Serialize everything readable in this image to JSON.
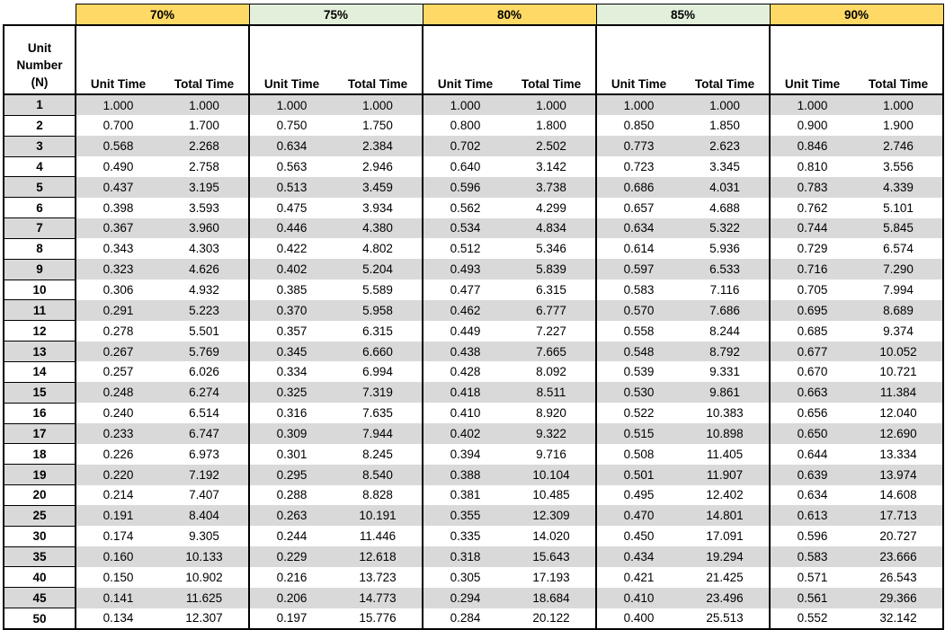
{
  "colors": {
    "yellow": "#ffd966",
    "green": "#e2efda",
    "row_gray": "#d9d9d9"
  },
  "header": {
    "unit_label_line1": "Unit",
    "unit_label_line2": "Number",
    "unit_label_line3": "(N)",
    "unit_time_label": "Unit Time",
    "total_time_label": "Total Time"
  },
  "groups": [
    {
      "label": "70%",
      "color": "#ffd966"
    },
    {
      "label": "75%",
      "color": "#e2efda"
    },
    {
      "label": "80%",
      "color": "#ffd966"
    },
    {
      "label": "85%",
      "color": "#e2efda"
    },
    {
      "label": "90%",
      "color": "#ffd966"
    }
  ],
  "rows": [
    {
      "n": "1",
      "values": [
        "1.000",
        "1.000",
        "1.000",
        "1.000",
        "1.000",
        "1.000",
        "1.000",
        "1.000",
        "1.000",
        "1.000"
      ]
    },
    {
      "n": "2",
      "values": [
        "0.700",
        "1.700",
        "0.750",
        "1.750",
        "0.800",
        "1.800",
        "0.850",
        "1.850",
        "0.900",
        "1.900"
      ]
    },
    {
      "n": "3",
      "values": [
        "0.568",
        "2.268",
        "0.634",
        "2.384",
        "0.702",
        "2.502",
        "0.773",
        "2.623",
        "0.846",
        "2.746"
      ]
    },
    {
      "n": "4",
      "values": [
        "0.490",
        "2.758",
        "0.563",
        "2.946",
        "0.640",
        "3.142",
        "0.723",
        "3.345",
        "0.810",
        "3.556"
      ]
    },
    {
      "n": "5",
      "values": [
        "0.437",
        "3.195",
        "0.513",
        "3.459",
        "0.596",
        "3.738",
        "0.686",
        "4.031",
        "0.783",
        "4.339"
      ]
    },
    {
      "n": "6",
      "values": [
        "0.398",
        "3.593",
        "0.475",
        "3.934",
        "0.562",
        "4.299",
        "0.657",
        "4.688",
        "0.762",
        "5.101"
      ]
    },
    {
      "n": "7",
      "values": [
        "0.367",
        "3.960",
        "0.446",
        "4.380",
        "0.534",
        "4.834",
        "0.634",
        "5.322",
        "0.744",
        "5.845"
      ]
    },
    {
      "n": "8",
      "values": [
        "0.343",
        "4.303",
        "0.422",
        "4.802",
        "0.512",
        "5.346",
        "0.614",
        "5.936",
        "0.729",
        "6.574"
      ]
    },
    {
      "n": "9",
      "values": [
        "0.323",
        "4.626",
        "0.402",
        "5.204",
        "0.493",
        "5.839",
        "0.597",
        "6.533",
        "0.716",
        "7.290"
      ]
    },
    {
      "n": "10",
      "values": [
        "0.306",
        "4.932",
        "0.385",
        "5.589",
        "0.477",
        "6.315",
        "0.583",
        "7.116",
        "0.705",
        "7.994"
      ]
    },
    {
      "n": "11",
      "values": [
        "0.291",
        "5.223",
        "0.370",
        "5.958",
        "0.462",
        "6.777",
        "0.570",
        "7.686",
        "0.695",
        "8.689"
      ]
    },
    {
      "n": "12",
      "values": [
        "0.278",
        "5.501",
        "0.357",
        "6.315",
        "0.449",
        "7.227",
        "0.558",
        "8.244",
        "0.685",
        "9.374"
      ]
    },
    {
      "n": "13",
      "values": [
        "0.267",
        "5.769",
        "0.345",
        "6.660",
        "0.438",
        "7.665",
        "0.548",
        "8.792",
        "0.677",
        "10.052"
      ]
    },
    {
      "n": "14",
      "values": [
        "0.257",
        "6.026",
        "0.334",
        "6.994",
        "0.428",
        "8.092",
        "0.539",
        "9.331",
        "0.670",
        "10.721"
      ]
    },
    {
      "n": "15",
      "values": [
        "0.248",
        "6.274",
        "0.325",
        "7.319",
        "0.418",
        "8.511",
        "0.530",
        "9.861",
        "0.663",
        "11.384"
      ]
    },
    {
      "n": "16",
      "values": [
        "0.240",
        "6.514",
        "0.316",
        "7.635",
        "0.410",
        "8.920",
        "0.522",
        "10.383",
        "0.656",
        "12.040"
      ]
    },
    {
      "n": "17",
      "values": [
        "0.233",
        "6.747",
        "0.309",
        "7.944",
        "0.402",
        "9.322",
        "0.515",
        "10.898",
        "0.650",
        "12.690"
      ]
    },
    {
      "n": "18",
      "values": [
        "0.226",
        "6.973",
        "0.301",
        "8.245",
        "0.394",
        "9.716",
        "0.508",
        "11.405",
        "0.644",
        "13.334"
      ]
    },
    {
      "n": "19",
      "values": [
        "0.220",
        "7.192",
        "0.295",
        "8.540",
        "0.388",
        "10.104",
        "0.501",
        "11.907",
        "0.639",
        "13.974"
      ]
    },
    {
      "n": "20",
      "values": [
        "0.214",
        "7.407",
        "0.288",
        "8.828",
        "0.381",
        "10.485",
        "0.495",
        "12.402",
        "0.634",
        "14.608"
      ]
    },
    {
      "n": "25",
      "values": [
        "0.191",
        "8.404",
        "0.263",
        "10.191",
        "0.355",
        "12.309",
        "0.470",
        "14.801",
        "0.613",
        "17.713"
      ]
    },
    {
      "n": "30",
      "values": [
        "0.174",
        "9.305",
        "0.244",
        "11.446",
        "0.335",
        "14.020",
        "0.450",
        "17.091",
        "0.596",
        "20.727"
      ]
    },
    {
      "n": "35",
      "values": [
        "0.160",
        "10.133",
        "0.229",
        "12.618",
        "0.318",
        "15.643",
        "0.434",
        "19.294",
        "0.583",
        "23.666"
      ]
    },
    {
      "n": "40",
      "values": [
        "0.150",
        "10.902",
        "0.216",
        "13.723",
        "0.305",
        "17.193",
        "0.421",
        "21.425",
        "0.571",
        "26.543"
      ]
    },
    {
      "n": "45",
      "values": [
        "0.141",
        "11.625",
        "0.206",
        "14.773",
        "0.294",
        "18.684",
        "0.410",
        "23.496",
        "0.561",
        "29.366"
      ]
    },
    {
      "n": "50",
      "values": [
        "0.134",
        "12.307",
        "0.197",
        "15.776",
        "0.284",
        "20.122",
        "0.400",
        "25.513",
        "0.552",
        "32.142"
      ]
    }
  ]
}
